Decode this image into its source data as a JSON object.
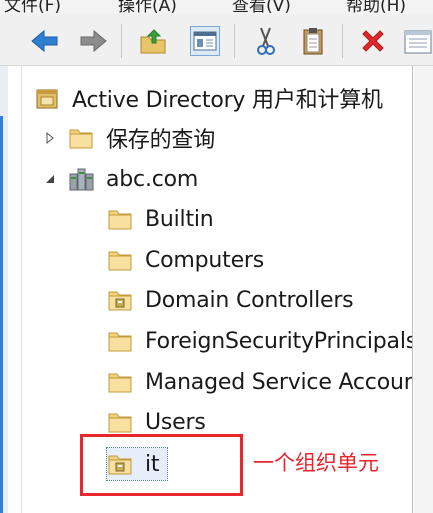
{
  "menu": {
    "items": [
      "文件(F)",
      "操作(A)",
      "查看(V)",
      "帮助(H)"
    ]
  },
  "toolbar": {
    "buttons": [
      "back-icon",
      "forward-icon",
      "up-folder-icon",
      "show-hide-console-tree-icon",
      "cut-icon",
      "paste-icon",
      "delete-icon",
      "properties-icon"
    ]
  },
  "tree": {
    "root_label": "Active Directory 用户和计算机",
    "saved_queries_label": "保存的查询",
    "domain_label": "abc.com",
    "children": [
      {
        "label": "Builtin",
        "icon": "folder-icon"
      },
      {
        "label": "Computers",
        "icon": "folder-icon"
      },
      {
        "label": "Domain Controllers",
        "icon": "ou-icon"
      },
      {
        "label": "ForeignSecurityPrincipals",
        "icon": "folder-icon"
      },
      {
        "label": "Managed Service Accounts",
        "icon": "folder-icon"
      },
      {
        "label": "Users",
        "icon": "folder-icon"
      },
      {
        "label": "it",
        "icon": "ou-icon"
      }
    ]
  },
  "annotation": {
    "text": "一个组织单元",
    "color": "#e8262c"
  }
}
